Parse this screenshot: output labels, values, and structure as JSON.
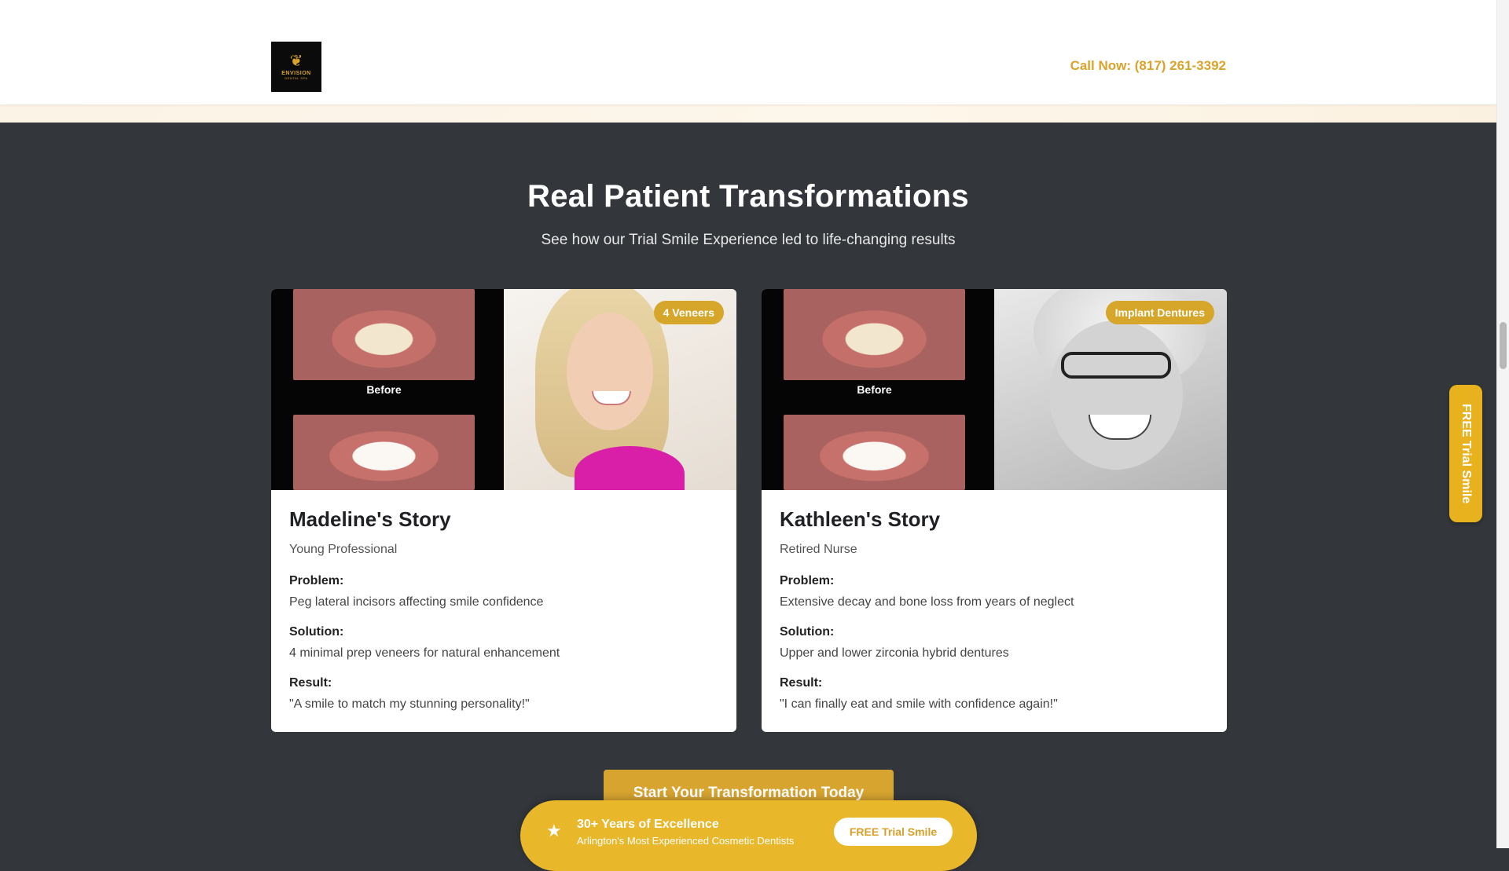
{
  "header": {
    "logo_brand": "ENVISION",
    "logo_sub": "DENTAL SPA",
    "call_label": "Call Now: (817) 261-3392"
  },
  "section": {
    "title": "Real Patient Transformations",
    "subtitle": "See how our Trial Smile Experience led to life-changing results"
  },
  "cards": [
    {
      "badge": "4 Veneers",
      "before_label": "Before",
      "name": "Madeline's Story",
      "role": "Young Professional",
      "problem_label": "Problem:",
      "problem": "Peg lateral incisors affecting smile confidence",
      "solution_label": "Solution:",
      "solution": "4 minimal prep veneers for natural enhancement",
      "result_label": "Result:",
      "result": "\"A smile to match my stunning personality!\""
    },
    {
      "badge": "Implant Dentures",
      "before_label": "Before",
      "name": "Kathleen's Story",
      "role": "Retired Nurse",
      "problem_label": "Problem:",
      "problem": "Extensive decay and bone loss from years of neglect",
      "solution_label": "Solution:",
      "solution": "Upper and lower zirconia hybrid dentures",
      "result_label": "Result:",
      "result": "\"I can finally eat and smile with confidence again!\""
    }
  ],
  "cta": {
    "label": "Start Your Transformation Today"
  },
  "bottom_bar": {
    "title": "30+ Years of Excellence",
    "subtitle": "Arlington's Most Experienced Cosmetic Dentists",
    "button": "FREE Trial Smile"
  },
  "side_tab": {
    "label": "FREE Trial Smile"
  },
  "colors": {
    "accent": "#d6a62b",
    "section_bg": "#33373c"
  },
  "icons": {
    "bottom_bar": "star-icon"
  }
}
